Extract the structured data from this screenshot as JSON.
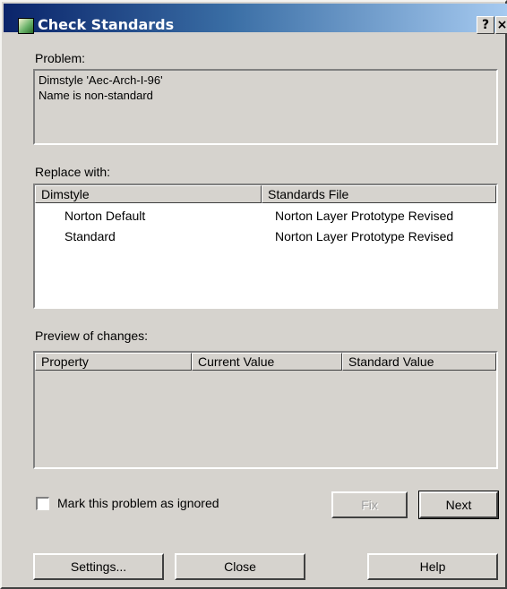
{
  "window": {
    "title": "Check Standards",
    "help_glyph": "?",
    "close_glyph": "×"
  },
  "problem": {
    "label": "Problem:",
    "lines": [
      "Dimstyle 'Aec-Arch-I-96'",
      "Name is non-standard"
    ]
  },
  "replace": {
    "label": "Replace with:",
    "columns": [
      "Dimstyle",
      "Standards File"
    ],
    "rows": [
      {
        "dimstyle": "Norton Default",
        "file": "Norton Layer Prototype Revised"
      },
      {
        "dimstyle": "Standard",
        "file": "Norton Layer Prototype Revised"
      }
    ]
  },
  "preview": {
    "label": "Preview of changes:",
    "columns": [
      "Property",
      "Current Value",
      "Standard Value"
    ]
  },
  "ignore": {
    "label": "Mark this problem as ignored",
    "checked": false
  },
  "buttons": {
    "fix": "Fix",
    "next": "Next",
    "settings": "Settings...",
    "close": "Close",
    "help": "Help"
  },
  "colors": {
    "title_gradient_start": "#0a246a",
    "title_gradient_end": "#a6caf0",
    "face": "#d6d3ce"
  },
  "icons": {
    "title_icon": "check-standards-app-icon"
  }
}
